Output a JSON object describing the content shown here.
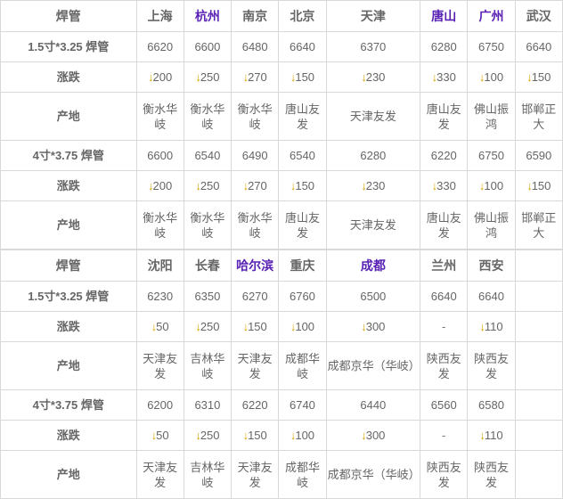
{
  "tables": [
    {
      "header": {
        "title": "焊管",
        "cities": [
          {
            "name": "上海",
            "style": "link"
          },
          {
            "name": "杭州",
            "style": "visited"
          },
          {
            "name": "南京",
            "style": "link"
          },
          {
            "name": "北京",
            "style": "link"
          },
          {
            "name": "天津",
            "style": "link"
          },
          {
            "name": "唐山",
            "style": "visited"
          },
          {
            "name": "广州",
            "style": "visited"
          },
          {
            "name": "武汉",
            "style": "link"
          }
        ]
      },
      "rows": [
        {
          "type": "price",
          "label": "1.5寸*3.25 焊管",
          "values": [
            "6620",
            "6600",
            "6480",
            "6640",
            "6370",
            "6280",
            "6750",
            "6640"
          ]
        },
        {
          "type": "change",
          "label": "涨跌",
          "values": [
            "↓200",
            "↓250",
            "↓270",
            "↓150",
            "↓230",
            "↓330",
            "↓100",
            "↓150"
          ]
        },
        {
          "type": "origin",
          "label": "产地",
          "values": [
            "衡水华岐",
            "衡水华岐",
            "衡水华岐",
            "唐山友发",
            "天津友发",
            "唐山友发",
            "佛山振鸿",
            "邯郸正大"
          ]
        },
        {
          "type": "price",
          "label": "4寸*3.75 焊管",
          "values": [
            "6600",
            "6540",
            "6490",
            "6540",
            "6280",
            "6220",
            "6750",
            "6590"
          ]
        },
        {
          "type": "change",
          "label": "涨跌",
          "values": [
            "↓200",
            "↓250",
            "↓270",
            "↓150",
            "↓230",
            "↓330",
            "↓100",
            "↓150"
          ]
        },
        {
          "type": "origin",
          "label": "产地",
          "values": [
            "衡水华岐",
            "衡水华岐",
            "衡水华岐",
            "唐山友发",
            "天津友发",
            "唐山友发",
            "佛山振鸿",
            "邯郸正大"
          ]
        }
      ]
    },
    {
      "header": {
        "title": "焊管",
        "cities": [
          {
            "name": "沈阳",
            "style": "link"
          },
          {
            "name": "长春",
            "style": "link"
          },
          {
            "name": "哈尔滨",
            "style": "visited"
          },
          {
            "name": "重庆",
            "style": "link"
          },
          {
            "name": "成都",
            "style": "visited"
          },
          {
            "name": "兰州",
            "style": "link"
          },
          {
            "name": "西安",
            "style": "link"
          },
          {
            "name": "",
            "style": "link"
          }
        ]
      },
      "rows": [
        {
          "type": "price",
          "label": "1.5寸*3.25 焊管",
          "values": [
            "6230",
            "6350",
            "6270",
            "6760",
            "6500",
            "6640",
            "6640",
            ""
          ]
        },
        {
          "type": "change",
          "label": "涨跌",
          "values": [
            "↓50",
            "↓250",
            "↓150",
            "↓100",
            "↓300",
            "-",
            "↓110",
            ""
          ]
        },
        {
          "type": "origin",
          "label": "产地",
          "values": [
            "天津友发",
            "吉林华岐",
            "天津友发",
            "成都华岐",
            "成都京华（华岐）",
            "陕西友发",
            "陕西友发",
            ""
          ]
        },
        {
          "type": "price",
          "label": "4寸*3.75 焊管",
          "values": [
            "6200",
            "6310",
            "6220",
            "6740",
            "6440",
            "6560",
            "6580",
            ""
          ]
        },
        {
          "type": "change",
          "label": "涨跌",
          "values": [
            "↓50",
            "↓250",
            "↓150",
            "↓100",
            "↓300",
            "-",
            "↓110",
            ""
          ]
        },
        {
          "type": "origin",
          "label": "产地",
          "values": [
            "天津友发",
            "吉林华岐",
            "天津友发",
            "成都华岐",
            "成都京华（华岐）",
            "陕西友发",
            "陕西友发",
            ""
          ]
        }
      ]
    }
  ],
  "colors": {
    "header_title": "#ff0000",
    "city_link": "#0000ee",
    "city_visited": "#5a22b4",
    "price_text": "#737373",
    "change_text": "#1a9c3c",
    "arrow": "#d9a400",
    "origin_text": "#8a8a8a",
    "border": "#d9d9d9"
  }
}
